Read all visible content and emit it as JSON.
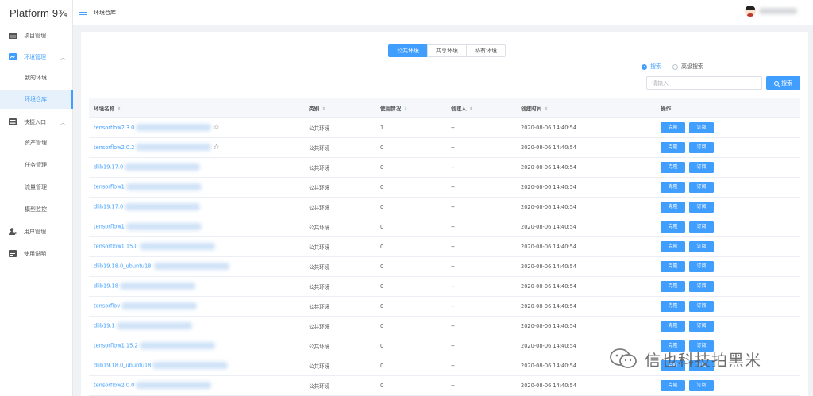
{
  "brand": {
    "title": "Platform 9¾"
  },
  "sidebar": {
    "items": [
      {
        "label": "项目管理",
        "icon": "folder-icon"
      },
      {
        "label": "环境管理",
        "icon": "chart-icon",
        "expanded": true
      },
      {
        "label": "我的环境"
      },
      {
        "label": "环境仓库",
        "active": true
      },
      {
        "label": "快捷入口",
        "icon": "server-icon",
        "expanded": true
      },
      {
        "label": "资产管理"
      },
      {
        "label": "任务管理"
      },
      {
        "label": "流量管理"
      },
      {
        "label": "模型监控"
      },
      {
        "label": "用户管理",
        "icon": "user-icon"
      },
      {
        "label": "使用说明",
        "icon": "book-icon"
      }
    ]
  },
  "header": {
    "breadcrumb": "环境仓库"
  },
  "tabs": [
    {
      "label": "公共环境",
      "active": true
    },
    {
      "label": "共享环境"
    },
    {
      "label": "私有环境"
    }
  ],
  "search": {
    "radio_basic": "搜索",
    "radio_advanced": "高级搜索",
    "placeholder": "请输入",
    "button": "搜索"
  },
  "table": {
    "headers": [
      "环境名称",
      "类别",
      "使用情况",
      "创建人",
      "创建时间",
      "操作"
    ],
    "actions": {
      "clone": "克隆",
      "subscribe": "订阅"
    },
    "rows": [
      {
        "name": "tensorflow2.3.0",
        "category": "公共环境",
        "usage": "1",
        "creator": "--",
        "created": "2020-08-06 14:40:54",
        "star": true
      },
      {
        "name": "tensorflow2.0.2",
        "category": "公共环境",
        "usage": "0",
        "creator": "--",
        "created": "2020-08-06 14:40:54",
        "star": true
      },
      {
        "name": "dlib19.17.0",
        "category": "公共环境",
        "usage": "0",
        "creator": "--",
        "created": "2020-08-06 14:40:54"
      },
      {
        "name": "tensorflow1",
        "category": "公共环境",
        "usage": "0",
        "creator": "--",
        "created": "2020-08-06 14:40:54"
      },
      {
        "name": "dlib19.17.0",
        "category": "公共环境",
        "usage": "0",
        "creator": "--",
        "created": "2020-08-06 14:40:54"
      },
      {
        "name": "tensorflow1",
        "category": "公共环境",
        "usage": "0",
        "creator": "--",
        "created": "2020-08-06 14:40:54"
      },
      {
        "name": "tensorflow1.15.0",
        "category": "公共环境",
        "usage": "0",
        "creator": "--",
        "created": "2020-08-06 14:40:54"
      },
      {
        "name": "dlib19.18.0_ubuntu18.",
        "category": "公共环境",
        "usage": "0",
        "creator": "--",
        "created": "2020-08-06 14:40:54"
      },
      {
        "name": "dlib19.18",
        "category": "公共环境",
        "usage": "0",
        "creator": "--",
        "created": "2020-08-06 14:40:54"
      },
      {
        "name": "tensorflov",
        "category": "公共环境",
        "usage": "0",
        "creator": "--",
        "created": "2020-08-06 14:40:54"
      },
      {
        "name": "dlib19.1",
        "category": "公共环境",
        "usage": "0",
        "creator": "--",
        "created": "2020-08-06 14:40:54"
      },
      {
        "name": "tensorflow1.15.2",
        "category": "公共环境",
        "usage": "0",
        "creator": "--",
        "created": "2020-08-06 14:40:54"
      },
      {
        "name": "dlib19.18.0_ubuntu18",
        "category": "公共环境",
        "usage": "0",
        "creator": "--",
        "created": "2020-08-06 14:40:54"
      },
      {
        "name": "tensorflow2.0.0",
        "category": "公共环境",
        "usage": "0",
        "creator": "--",
        "created": "2020-08-06 14:40:54"
      }
    ]
  },
  "watermark": {
    "text": "信也科技拍黑米"
  },
  "colors": {
    "primary": "#409eff",
    "sidebar_active_bg": "#e6f1fc"
  }
}
